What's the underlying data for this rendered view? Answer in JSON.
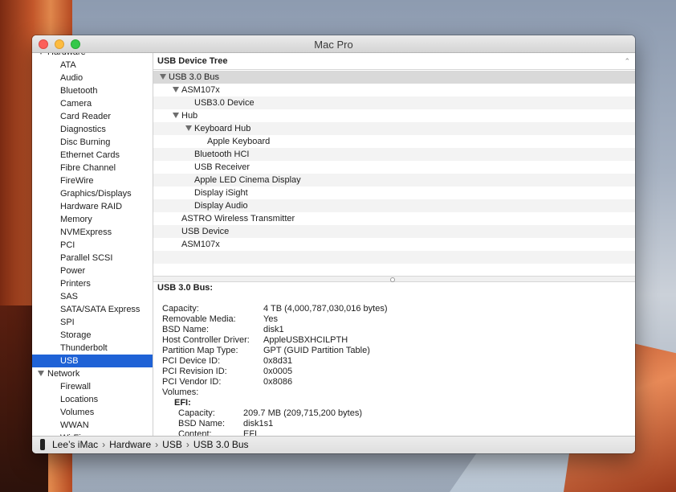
{
  "window": {
    "title": "Mac Pro"
  },
  "sidebar": {
    "items": [
      {
        "label": "Hardware",
        "type": "category"
      },
      {
        "label": "ATA"
      },
      {
        "label": "Audio"
      },
      {
        "label": "Bluetooth"
      },
      {
        "label": "Camera"
      },
      {
        "label": "Card Reader"
      },
      {
        "label": "Diagnostics"
      },
      {
        "label": "Disc Burning"
      },
      {
        "label": "Ethernet Cards"
      },
      {
        "label": "Fibre Channel"
      },
      {
        "label": "FireWire"
      },
      {
        "label": "Graphics/Displays"
      },
      {
        "label": "Hardware RAID"
      },
      {
        "label": "Memory"
      },
      {
        "label": "NVMExpress"
      },
      {
        "label": "PCI"
      },
      {
        "label": "Parallel SCSI"
      },
      {
        "label": "Power"
      },
      {
        "label": "Printers"
      },
      {
        "label": "SAS"
      },
      {
        "label": "SATA/SATA Express"
      },
      {
        "label": "SPI"
      },
      {
        "label": "Storage"
      },
      {
        "label": "Thunderbolt"
      },
      {
        "label": "USB",
        "selected": true
      },
      {
        "label": "Network",
        "type": "category"
      },
      {
        "label": "Firewall"
      },
      {
        "label": "Locations"
      },
      {
        "label": "Volumes"
      },
      {
        "label": "WWAN"
      },
      {
        "label": "Wi-Fi"
      }
    ]
  },
  "tree": {
    "header": "USB Device Tree",
    "rows": [
      {
        "label": "USB 3.0 Bus",
        "level": 0,
        "expanded": true,
        "selected": true
      },
      {
        "label": "ASM107x",
        "level": 1,
        "expanded": true
      },
      {
        "label": "USB3.0 Device",
        "level": 2
      },
      {
        "label": "Hub",
        "level": 1,
        "expanded": true
      },
      {
        "label": "Keyboard Hub",
        "level": 2,
        "expanded": true
      },
      {
        "label": "Apple Keyboard",
        "level": 3
      },
      {
        "label": "Bluetooth HCI",
        "level": 2
      },
      {
        "label": "USB Receiver",
        "level": 2
      },
      {
        "label": "Apple LED Cinema Display",
        "level": 2
      },
      {
        "label": "Display iSight",
        "level": 2
      },
      {
        "label": "Display Audio",
        "level": 2
      },
      {
        "label": "ASTRO Wireless Transmitter",
        "level": 1
      },
      {
        "label": "USB Device",
        "level": 1
      },
      {
        "label": "ASM107x",
        "level": 1
      },
      {
        "label": "",
        "level": 0
      },
      {
        "label": "",
        "level": 0
      }
    ]
  },
  "detail": {
    "title": "USB 3.0 Bus:",
    "fields": [
      {
        "key": "Capacity:",
        "value": "4 TB (4,000,787,030,016 bytes)"
      },
      {
        "key": "Removable Media:",
        "value": "Yes"
      },
      {
        "key": "BSD Name:",
        "value": "disk1"
      },
      {
        "key": "Host Controller Driver:",
        "value": "AppleUSBXHCILPTH"
      },
      {
        "key": "Partition Map Type:",
        "value": "GPT (GUID Partition Table)"
      },
      {
        "key": "PCI Device ID:",
        "value": "0x8d31"
      },
      {
        "key": "PCI Revision ID:",
        "value": "0x0005"
      },
      {
        "key": "PCI Vendor ID:",
        "value": "0x8086"
      }
    ],
    "volumes_label": "Volumes:",
    "efi": {
      "label": "EFI:",
      "fields": [
        {
          "key": "Capacity:",
          "value": "209.7 MB (209,715,200 bytes)"
        },
        {
          "key": "BSD Name:",
          "value": "disk1s1"
        },
        {
          "key": "Content:",
          "value": "EFI"
        }
      ]
    }
  },
  "statusbar": {
    "crumbs": [
      "Lee’s iMac",
      "Hardware",
      "USB",
      "USB 3.0 Bus"
    ],
    "separator": "›"
  },
  "colors": {
    "selection": "#1f62d6"
  }
}
